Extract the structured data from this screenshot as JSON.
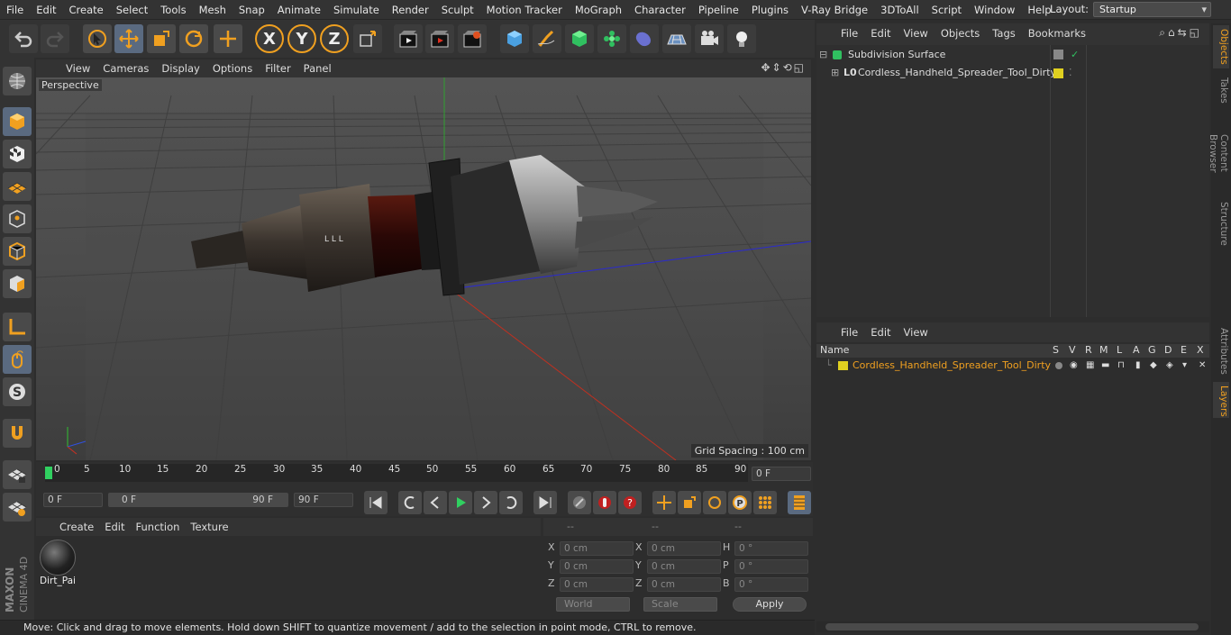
{
  "menubar": {
    "items": [
      "File",
      "Edit",
      "Create",
      "Select",
      "Tools",
      "Mesh",
      "Snap",
      "Animate",
      "Simulate",
      "Render",
      "Sculpt",
      "Motion Tracker",
      "MoGraph",
      "Character",
      "Pipeline",
      "Plugins",
      "V-Ray Bridge",
      "3DToAll",
      "Script",
      "Window",
      "Help"
    ],
    "layout_label": "Layout:",
    "layout_value": "Startup"
  },
  "toolbar": {
    "axis_x": "X",
    "axis_y": "Y",
    "axis_z": "Z"
  },
  "viewport": {
    "menu": [
      "View",
      "Cameras",
      "Display",
      "Options",
      "Filter",
      "Panel"
    ],
    "label": "Perspective",
    "grid_spacing": "Grid Spacing : 100 cm"
  },
  "timeline": {
    "ticks": [
      "0",
      "5",
      "10",
      "15",
      "20",
      "25",
      "30",
      "35",
      "40",
      "45",
      "50",
      "55",
      "60",
      "65",
      "70",
      "75",
      "80",
      "85",
      "90"
    ],
    "current_frame": "0 F",
    "start_frame": "0 F",
    "range_start": "0 F",
    "range_end": "90 F",
    "end_frame": "90 F"
  },
  "material": {
    "menu": [
      "Create",
      "Edit",
      "Function",
      "Texture"
    ],
    "items": [
      {
        "name": "Dirt_Pai"
      }
    ]
  },
  "coords": {
    "head": [
      "--",
      "--",
      "--"
    ],
    "rows": [
      {
        "a": "X",
        "av": "0 cm",
        "b": "X",
        "bv": "0 cm",
        "c": "H",
        "cv": "0 °"
      },
      {
        "a": "Y",
        "av": "0 cm",
        "b": "Y",
        "bv": "0 cm",
        "c": "P",
        "cv": "0 °"
      },
      {
        "a": "Z",
        "av": "0 cm",
        "b": "Z",
        "bv": "0 cm",
        "c": "B",
        "cv": "0 °"
      }
    ],
    "world": "World",
    "scale": "Scale",
    "apply": "Apply"
  },
  "status": "Move: Click and drag to move elements. Hold down SHIFT to quantize movement / add to the selection in point mode, CTRL to remove.",
  "objects": {
    "menu": [
      "File",
      "Edit",
      "View",
      "Objects",
      "Tags",
      "Bookmarks"
    ],
    "rows": [
      {
        "name": "Subdivision Surface"
      },
      {
        "name": "Cordless_Handheld_Spreader_Tool_Dirty"
      }
    ]
  },
  "layers": {
    "menu": [
      "File",
      "Edit",
      "View"
    ],
    "columns": [
      "Name",
      "S",
      "V",
      "R",
      "M",
      "L",
      "A",
      "G",
      "D",
      "E",
      "X"
    ],
    "row": "Cordless_Handheld_Spreader_Tool_Dirty",
    "layer_color": "#e0d020"
  },
  "right_tabs": [
    "Objects",
    "Takes",
    "Content Browser",
    "Structure",
    "Attributes",
    "Layers"
  ],
  "logo": {
    "brand": "MAXON",
    "product": "CINEMA 4D"
  },
  "colors": {
    "accent": "#f0a020",
    "layer_text": "#f0a020"
  }
}
